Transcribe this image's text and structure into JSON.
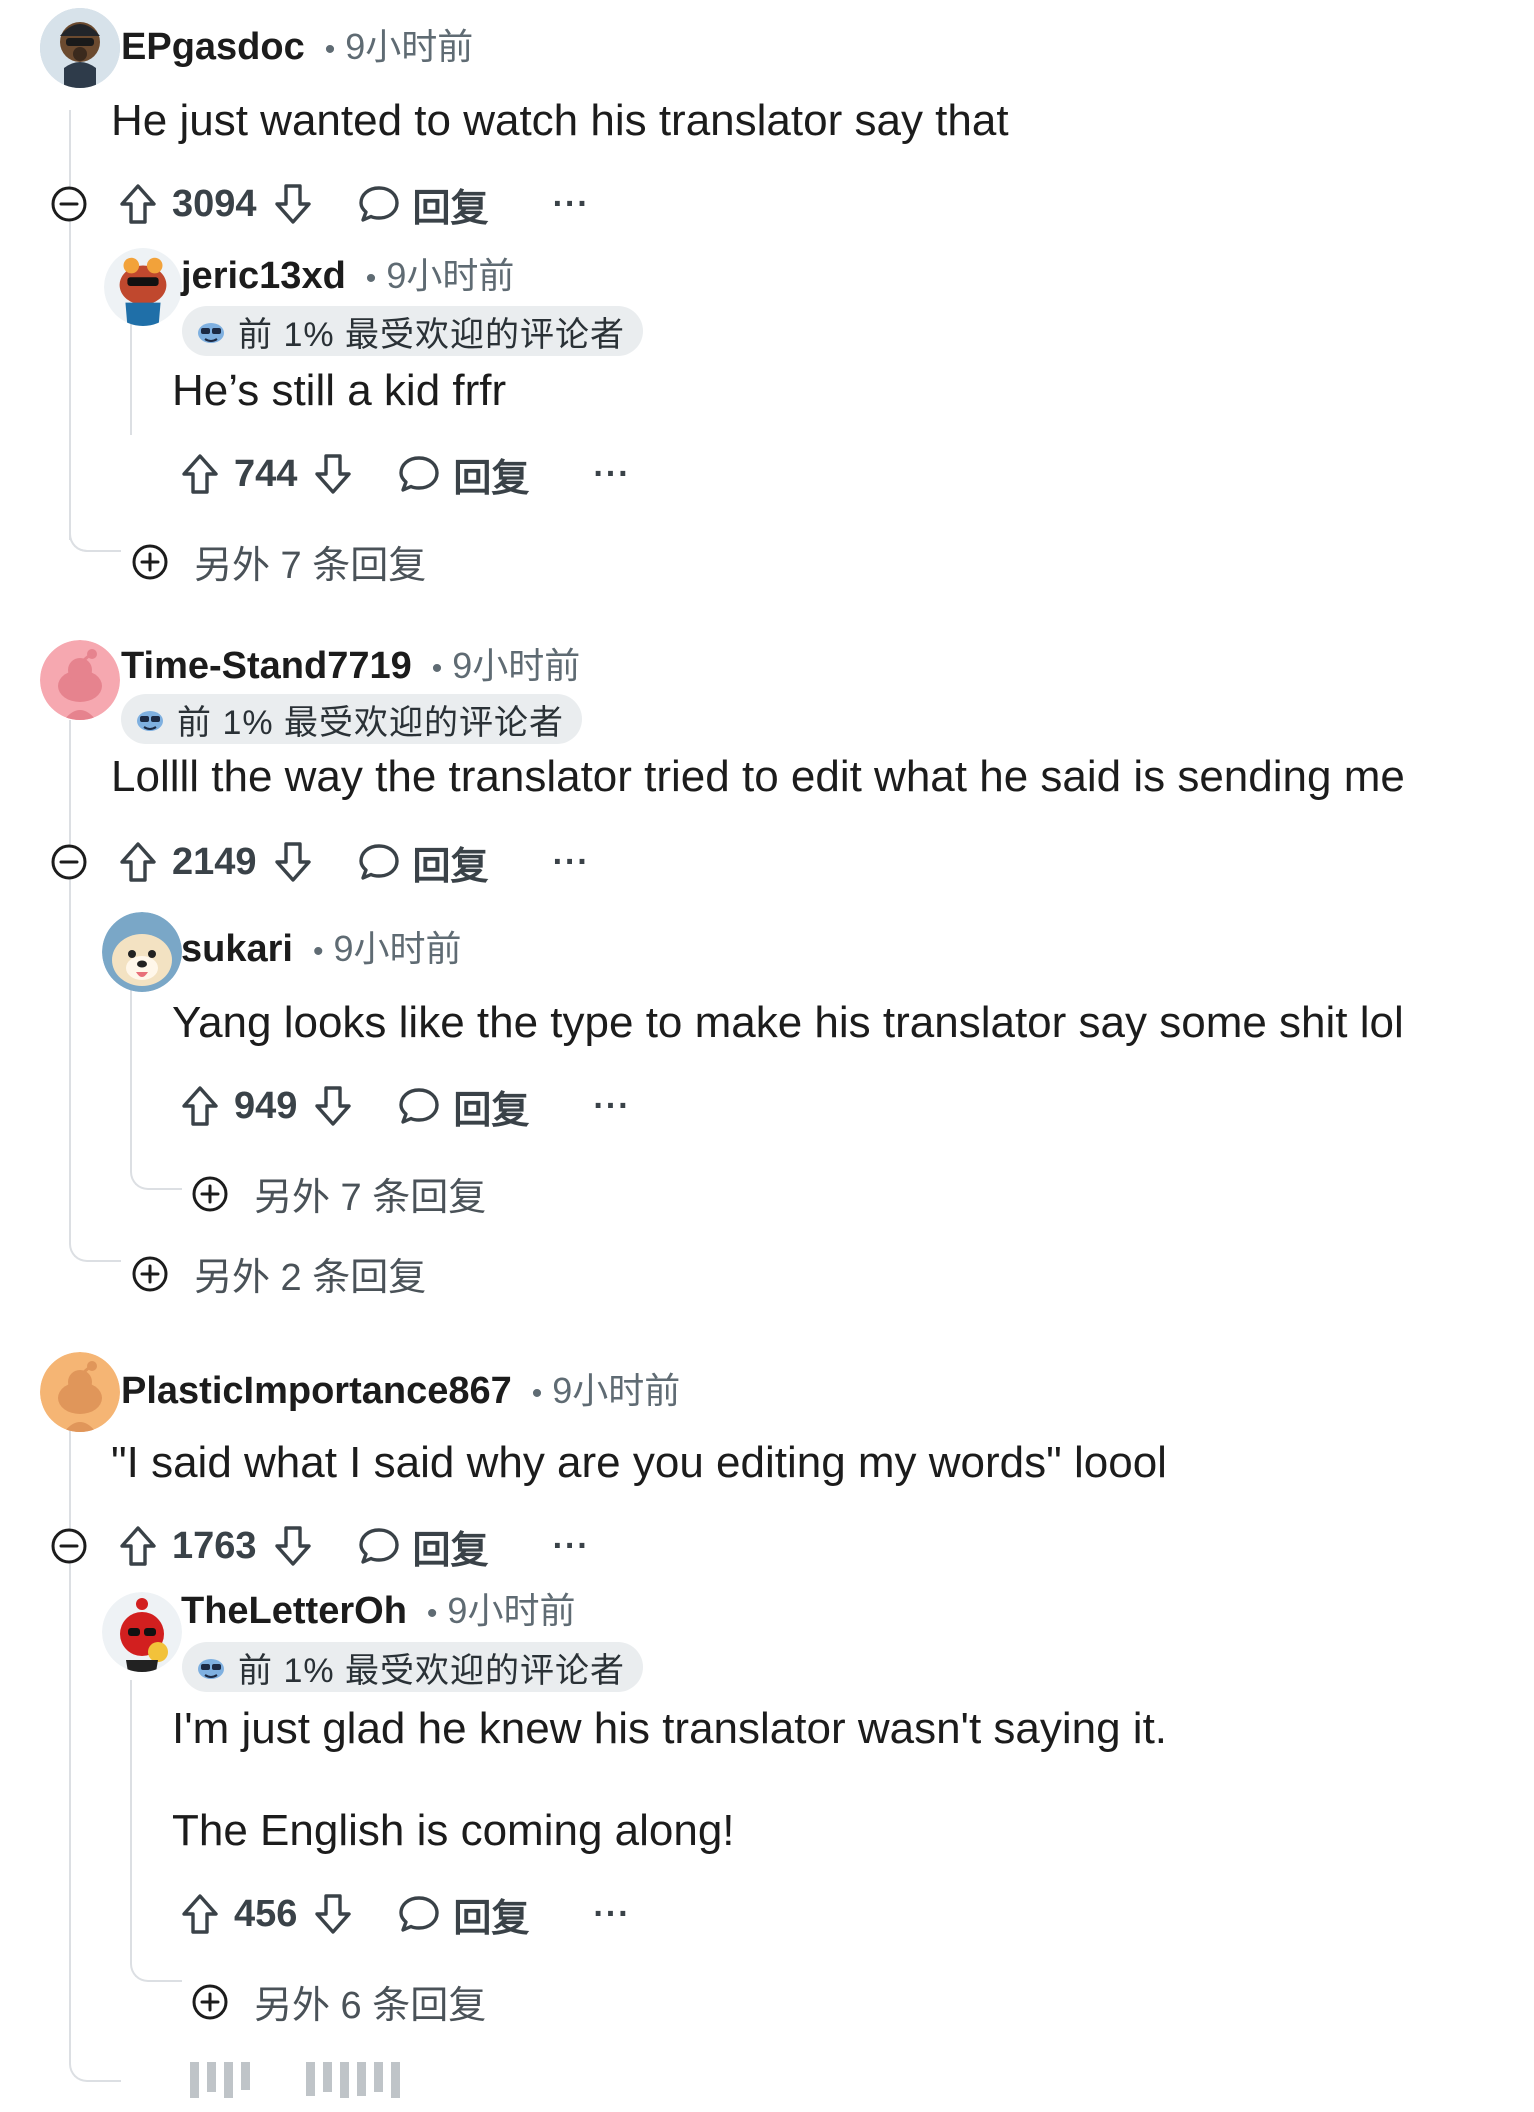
{
  "comments": [
    {
      "username": "EPgasdoc",
      "time": "9小时前",
      "body": "He just wanted to watch his translator say that",
      "votes": "3094",
      "reply_label": "回复",
      "more_label": "···",
      "replies": [
        {
          "username": "jeric13xd",
          "time": "9小时前",
          "flair": "前 1% 最受欢迎的评论者",
          "body": "He’s still a kid frfr",
          "votes": "744",
          "reply_label": "回复",
          "more_label": "···",
          "more_replies": "另外 7 条回复"
        }
      ]
    },
    {
      "username": "Time-Stand7719",
      "time": "9小时前",
      "flair": "前 1% 最受欢迎的评论者",
      "body": "Lollll the way the translator tried to edit what he said is sending me",
      "votes": "2149",
      "reply_label": "回复",
      "more_label": "···",
      "more_replies": "另外 2 条回复",
      "replies": [
        {
          "username": "sukari",
          "time": "9小时前",
          "body": "Yang looks like the type to make his translator say some shit lol",
          "votes": "949",
          "reply_label": "回复",
          "more_label": "···",
          "more_replies": "另外 7 条回复"
        }
      ]
    },
    {
      "username": "PlasticImportance867",
      "time": "9小时前",
      "body": "\"I said what I said why are you editing my words\" loool",
      "votes": "1763",
      "reply_label": "回复",
      "more_label": "···",
      "replies": [
        {
          "username": "TheLetterOh",
          "time": "9小时前",
          "flair": "前 1% 最受欢迎的评论者",
          "body_lines": [
            "I'm just glad he knew his translator wasn't saying it.",
            "The English is coming along!"
          ],
          "votes": "456",
          "reply_label": "回复",
          "more_label": "···",
          "more_replies": "另外 6 条回复"
        }
      ]
    }
  ],
  "icons": {
    "upvote": "arrow-up-outline-icon",
    "downvote": "arrow-down-outline-icon",
    "reply": "speech-bubble-icon",
    "collapse": "circle-minus-icon",
    "expand": "circle-plus-icon",
    "flair": "sunglasses-snoo-icon"
  },
  "colors": {
    "text": "#1c1c1c",
    "meta": "#5f6b73",
    "thread_line": "#dcdfe3",
    "flair_bg": "#eaedef"
  }
}
